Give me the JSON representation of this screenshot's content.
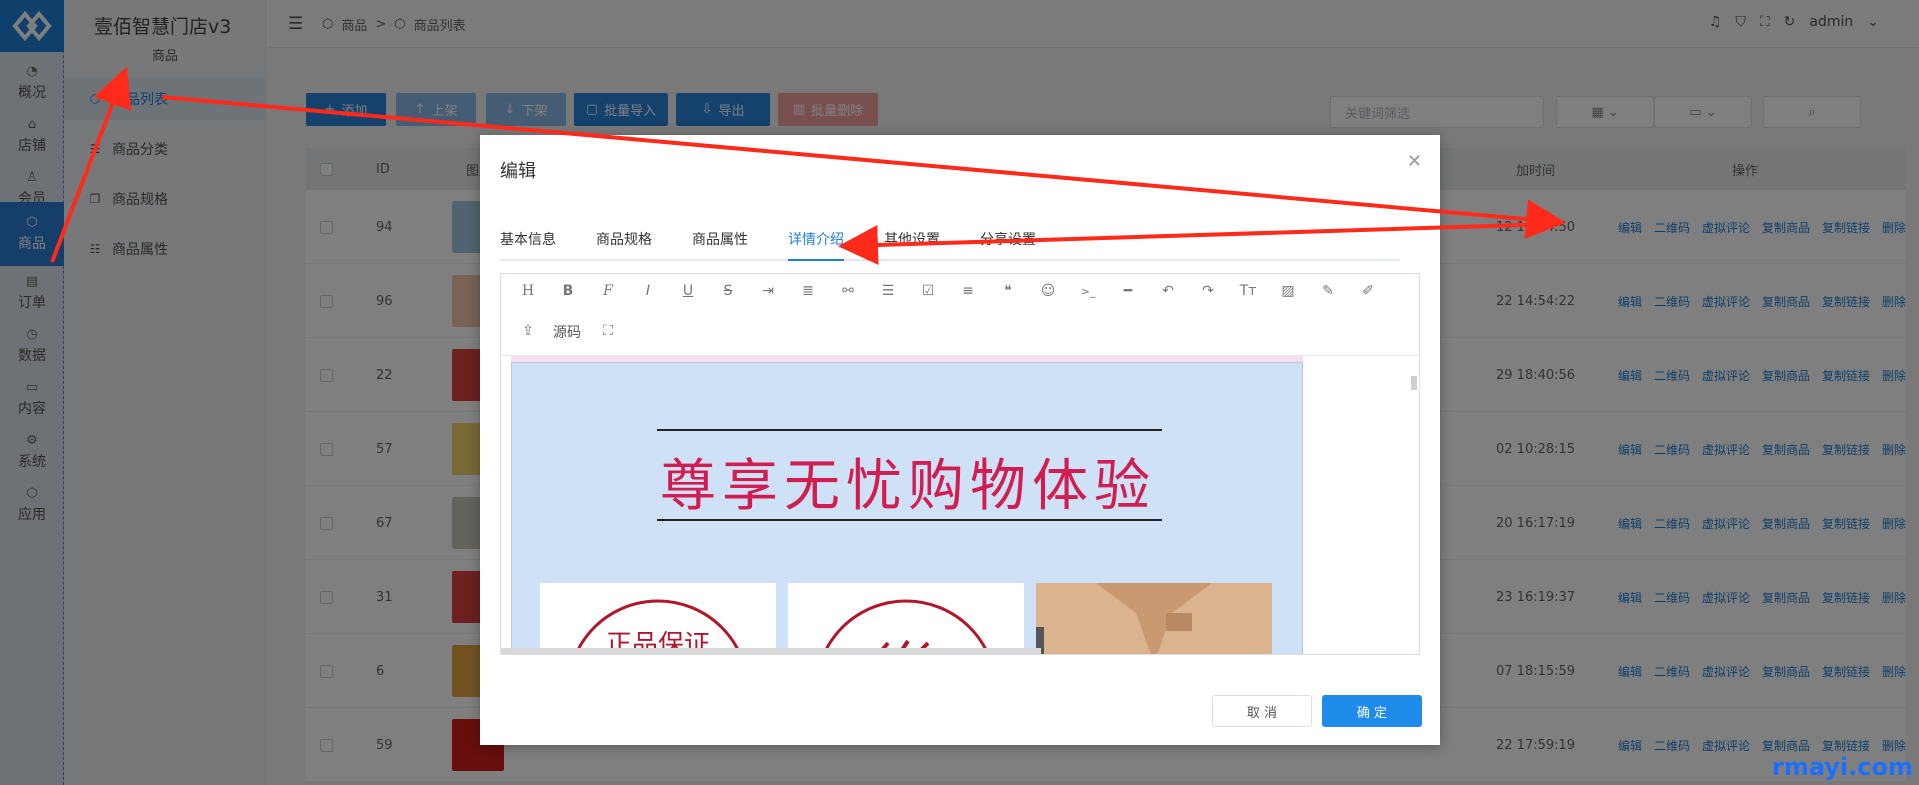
{
  "app": {
    "title": "壹佰智慧门店v3",
    "module": "商品"
  },
  "nav": [
    {
      "label": "概况",
      "icon": "dashboard-icon"
    },
    {
      "label": "店铺",
      "icon": "store-icon"
    },
    {
      "label": "会员",
      "icon": "user-icon"
    },
    {
      "label": "商品",
      "icon": "box-icon",
      "active": true
    },
    {
      "label": "订单",
      "icon": "order-icon"
    },
    {
      "label": "数据",
      "icon": "pie-icon"
    },
    {
      "label": "内容",
      "icon": "folder-icon"
    },
    {
      "label": "系统",
      "icon": "gear-icon"
    },
    {
      "label": "应用",
      "icon": "app-icon"
    }
  ],
  "submenu": [
    {
      "label": "商品列表",
      "icon": "box-icon",
      "active": true
    },
    {
      "label": "商品分类",
      "icon": "list-icon"
    },
    {
      "label": "商品规格",
      "icon": "copy-icon"
    },
    {
      "label": "商品属性",
      "icon": "sliders-icon"
    }
  ],
  "breadcrumb": {
    "root": "商品",
    "sep": ">",
    "current": "商品列表"
  },
  "header": {
    "user": "admin"
  },
  "toolbar": {
    "add": "添加",
    "on_shelf": "上架",
    "off_shelf": "下架",
    "bulk_import": "批量导入",
    "export": "导出",
    "bulk_delete": "批量删除"
  },
  "search": {
    "placeholder": "关键词筛选"
  },
  "table": {
    "headers": {
      "id": "ID",
      "image": "图片",
      "time": "加时间",
      "ops": "操作"
    },
    "rows": [
      {
        "id": "94",
        "time": "12 18:54:50"
      },
      {
        "id": "96",
        "time": "22 14:54:22"
      },
      {
        "id": "22",
        "time": "29 18:40:56"
      },
      {
        "id": "57",
        "time": "02 10:28:15"
      },
      {
        "id": "67",
        "time": "20 16:17:19"
      },
      {
        "id": "31",
        "time": "23 16:19:37"
      },
      {
        "id": "6",
        "time": "07 18:15:59"
      },
      {
        "id": "59",
        "time": "22 17:59:19"
      }
    ],
    "ops": [
      "编辑",
      "二维码",
      "虚拟评论",
      "复制商品",
      "复制链接",
      "删除"
    ]
  },
  "dialog": {
    "title": "编辑",
    "tabs": [
      "基本信息",
      "商品规格",
      "商品属性",
      "详情介绍",
      "其他设置",
      "分享设置"
    ],
    "active_tab": "详情介绍",
    "editor": {
      "source_label": "源码",
      "banner_text": "尊享无忧购物体验",
      "stamp_text": "正品保证"
    },
    "cancel": "取 消",
    "confirm": "确 定"
  },
  "colors": {
    "primary": "#1f7fd6",
    "danger": "#f56c6c",
    "banner_text": "#d11d4f",
    "arrow": "#ff2a1a"
  },
  "watermark": "rmayi.com"
}
